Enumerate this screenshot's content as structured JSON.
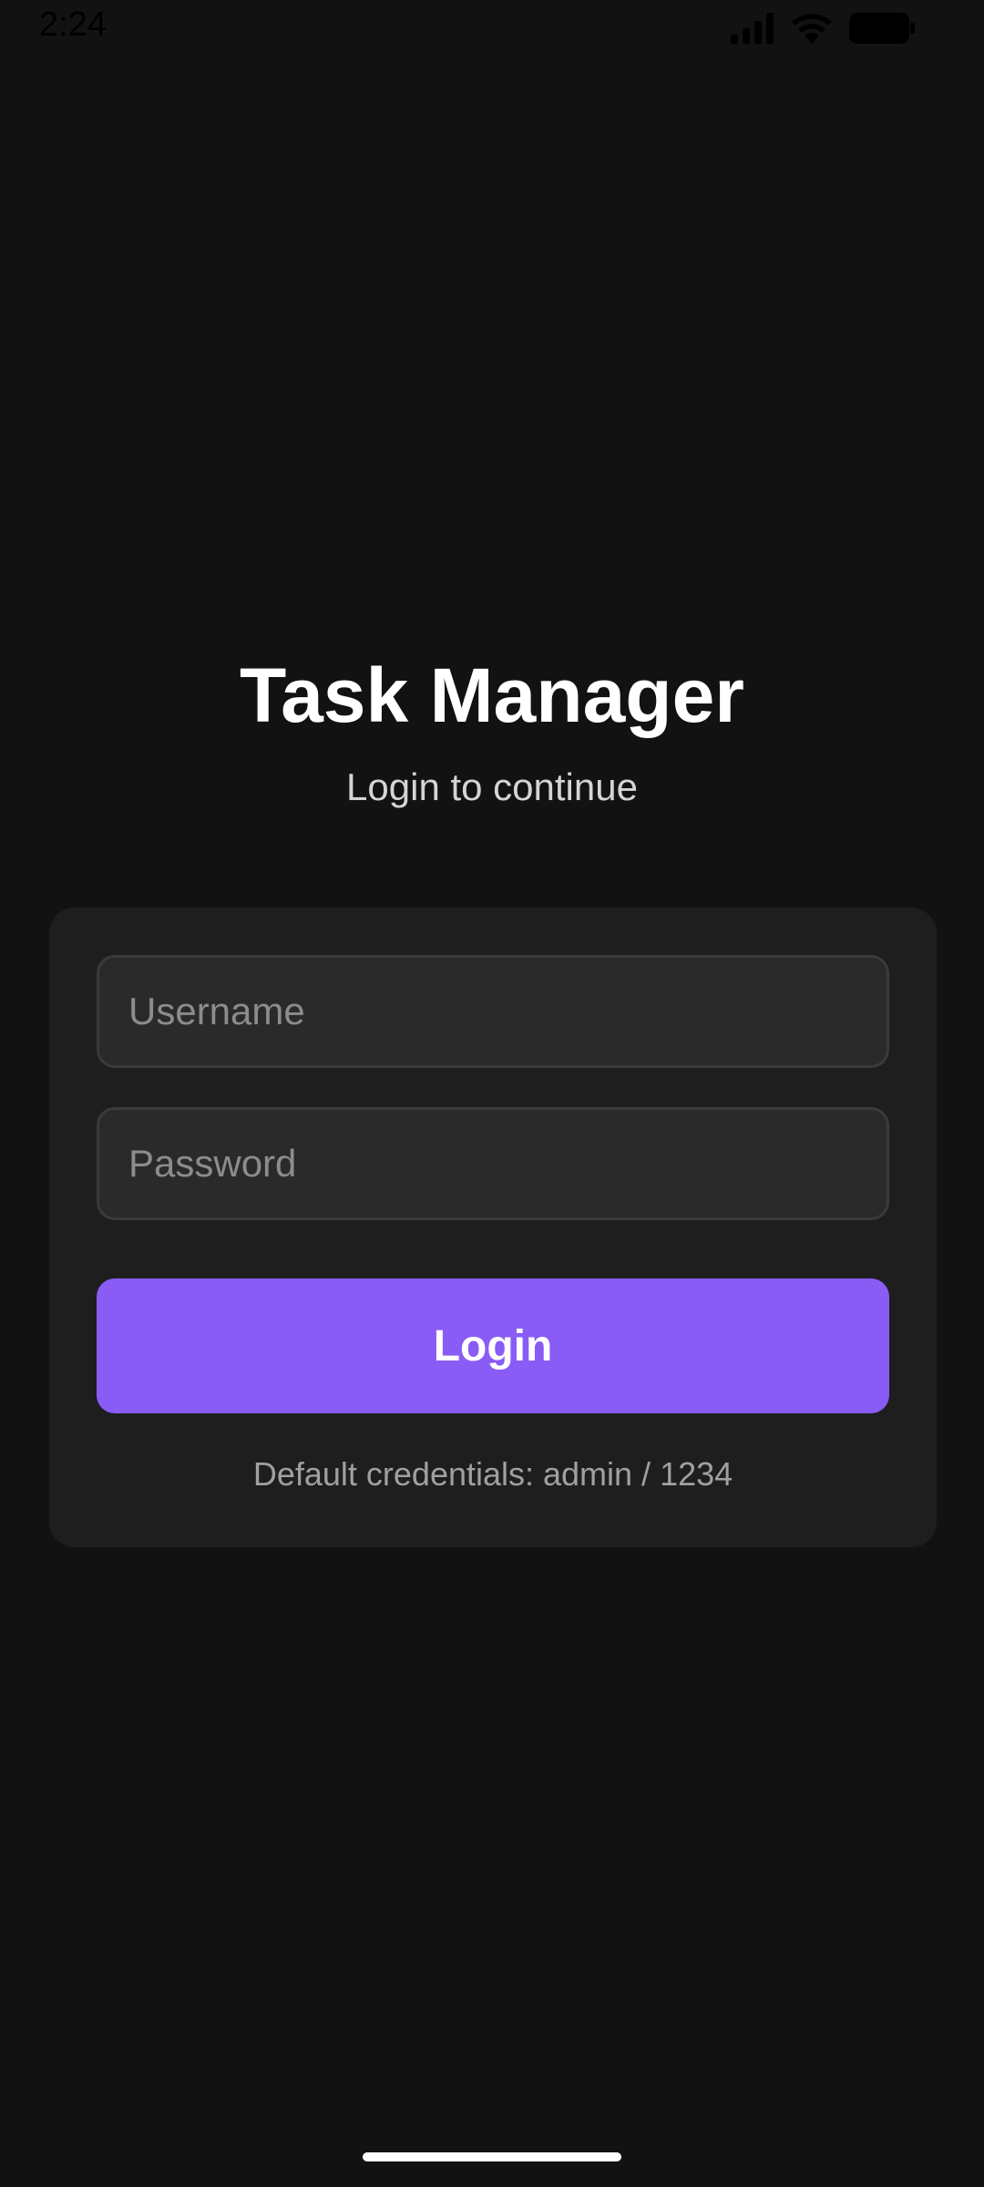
{
  "status_bar": {
    "time": "2:24",
    "icons": [
      "signal-icon",
      "wifi-icon",
      "battery-icon"
    ]
  },
  "header": {
    "title": "Task Manager",
    "subtitle": "Login to continue"
  },
  "form": {
    "username": {
      "value": "",
      "placeholder": "Username"
    },
    "password": {
      "value": "",
      "placeholder": "Password"
    },
    "login_label": "Login",
    "hint": "Default credentials: admin / 1234"
  },
  "colors": {
    "background": "#121212",
    "card": "#1e1e1e",
    "accent": "#8a5cf6",
    "input_bg": "#2a2a2a"
  }
}
